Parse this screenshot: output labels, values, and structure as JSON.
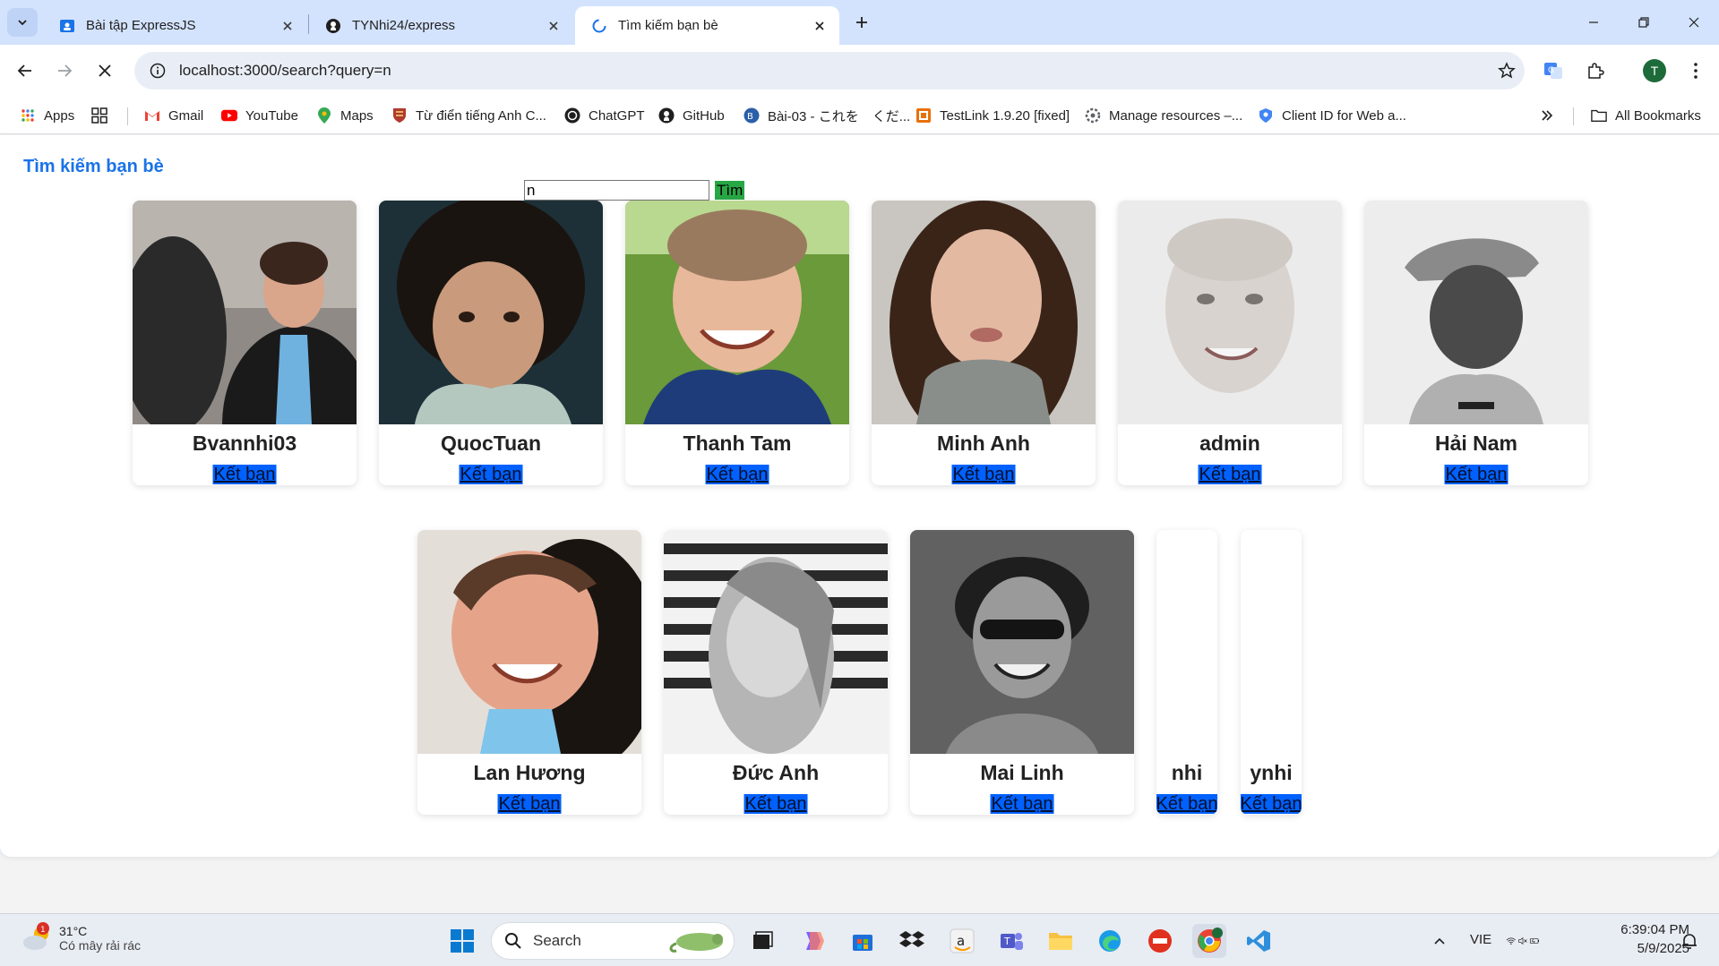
{
  "browser": {
    "tabs": [
      {
        "title": "Bài tập ExpressJS",
        "icon": "classroom-icon"
      },
      {
        "title": "TYNhi24/express",
        "icon": "github-icon"
      },
      {
        "title": "Tìm kiếm bạn bè",
        "icon": "loading-icon",
        "active": true
      }
    ],
    "url": "localhost:3000/search?query=n",
    "profile_initial": "T"
  },
  "bookmarks": [
    {
      "label": "Apps"
    },
    {
      "label": ""
    },
    {
      "label": "Gmail"
    },
    {
      "label": "YouTube"
    },
    {
      "label": "Maps"
    },
    {
      "label": "Từ điển tiếng Anh C..."
    },
    {
      "label": "ChatGPT"
    },
    {
      "label": "GitHub"
    },
    {
      "label": "Bài-03 - これを　くだ..."
    },
    {
      "label": "TestLink 1.9.20 [fixed]"
    },
    {
      "label": "Manage resources –..."
    },
    {
      "label": "Client ID for Web a..."
    }
  ],
  "all_bookmarks_label": "All Bookmarks",
  "page": {
    "title": "Tìm kiếm bạn bè",
    "search_value": "n",
    "search_button": "Tìm",
    "add_friend_label": "Kết bạn",
    "friends": [
      {
        "name": "Bvannhi03",
        "photo": true
      },
      {
        "name": "QuocTuan",
        "photo": true
      },
      {
        "name": "Thanh Tam",
        "photo": true
      },
      {
        "name": "Minh Anh",
        "photo": true
      },
      {
        "name": "admin",
        "photo": true
      },
      {
        "name": "Hải Nam",
        "photo": true
      },
      {
        "name": "Lan Hương",
        "photo": true
      },
      {
        "name": "Đức Anh",
        "photo": true
      },
      {
        "name": "Mai Linh",
        "photo": true
      },
      {
        "name": "nhi",
        "photo": false
      },
      {
        "name": "ynhi",
        "photo": false
      }
    ]
  },
  "taskbar": {
    "weather_temp": "31°C",
    "weather_desc": "Có mây rải rác",
    "weather_badge": "1",
    "search_label": "Search",
    "language": "VIE",
    "time": "6:39:04 PM",
    "date": "5/9/2025"
  },
  "colors": {
    "title_blue": "#1a73e8",
    "add_button": "#0061ff",
    "search_button": "#28a745"
  }
}
